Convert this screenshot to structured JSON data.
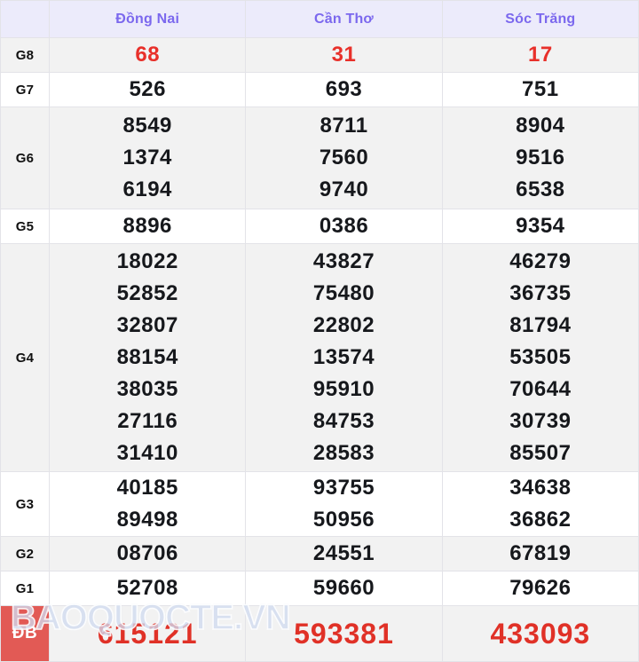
{
  "table": {
    "corner_label": "",
    "columns": [
      "Đồng Nai",
      "Cần Thơ",
      "Sóc Trăng"
    ],
    "header_color": "#7b68ee",
    "header_bg": "#ecebfb",
    "accent_red": "#e8302a",
    "db_badge_bg": "#e25a55",
    "rows": [
      {
        "label": "G8",
        "style": "red",
        "values": {
          "dong_nai": [
            "68"
          ],
          "can_tho": [
            "31"
          ],
          "soc_trang": [
            "17"
          ]
        }
      },
      {
        "label": "G7",
        "style": "normal",
        "values": {
          "dong_nai": [
            "526"
          ],
          "can_tho": [
            "693"
          ],
          "soc_trang": [
            "751"
          ]
        }
      },
      {
        "label": "G6",
        "style": "normal",
        "values": {
          "dong_nai": [
            "8549",
            "1374",
            "6194"
          ],
          "can_tho": [
            "8711",
            "7560",
            "9740"
          ],
          "soc_trang": [
            "8904",
            "9516",
            "6538"
          ]
        }
      },
      {
        "label": "G5",
        "style": "normal",
        "values": {
          "dong_nai": [
            "8896"
          ],
          "can_tho": [
            "0386"
          ],
          "soc_trang": [
            "9354"
          ]
        }
      },
      {
        "label": "G4",
        "style": "normal",
        "values": {
          "dong_nai": [
            "18022",
            "52852",
            "32807",
            "88154",
            "38035",
            "27116",
            "31410"
          ],
          "can_tho": [
            "43827",
            "75480",
            "22802",
            "13574",
            "95910",
            "84753",
            "28583"
          ],
          "soc_trang": [
            "46279",
            "36735",
            "81794",
            "53505",
            "70644",
            "30739",
            "85507"
          ]
        }
      },
      {
        "label": "G3",
        "style": "normal",
        "values": {
          "dong_nai": [
            "40185",
            "89498"
          ],
          "can_tho": [
            "93755",
            "50956"
          ],
          "soc_trang": [
            "34638",
            "36862"
          ]
        }
      },
      {
        "label": "G2",
        "style": "normal",
        "values": {
          "dong_nai": [
            "08706"
          ],
          "can_tho": [
            "24551"
          ],
          "soc_trang": [
            "67819"
          ]
        }
      },
      {
        "label": "G1",
        "style": "normal",
        "values": {
          "dong_nai": [
            "52708"
          ],
          "can_tho": [
            "59660"
          ],
          "soc_trang": [
            "79626"
          ]
        }
      },
      {
        "label": "ĐB",
        "style": "special",
        "values": {
          "dong_nai": [
            "615121"
          ],
          "can_tho": [
            "593381"
          ],
          "soc_trang": [
            "433093"
          ]
        }
      }
    ]
  },
  "watermark": {
    "text": "BAOQUOCTE.VN"
  }
}
